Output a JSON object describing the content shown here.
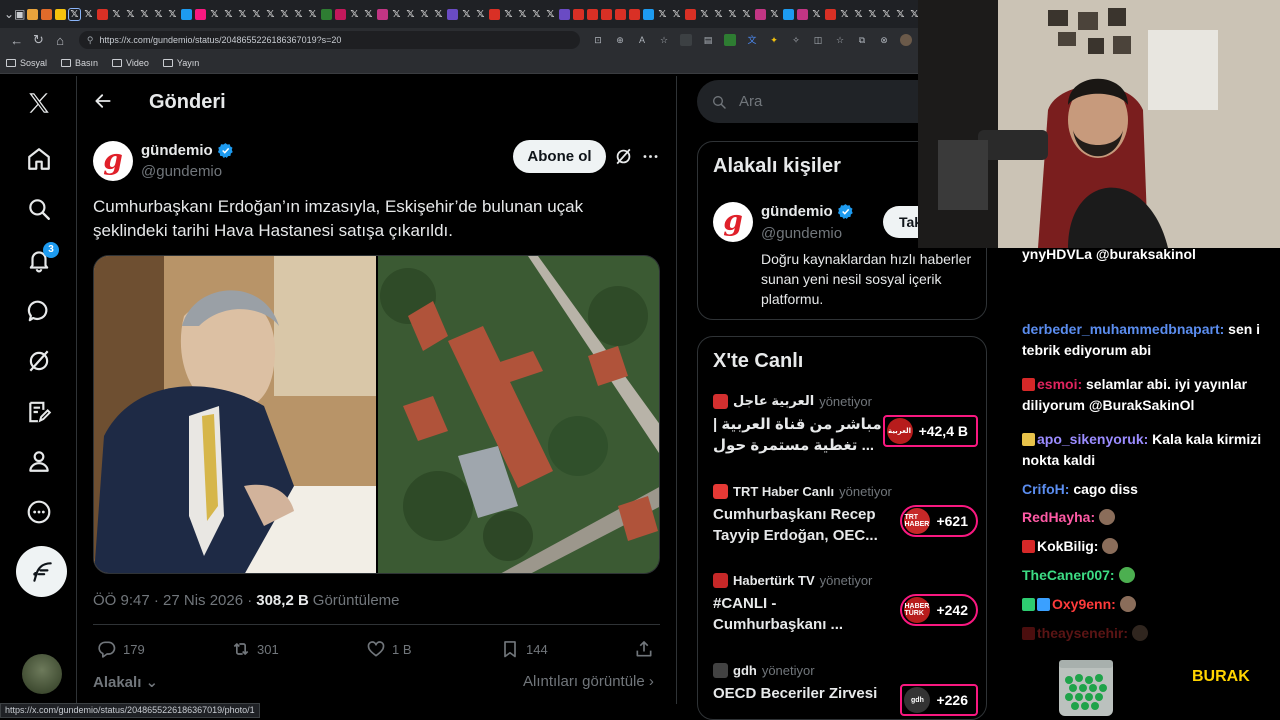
{
  "browser": {
    "url": "https://x.com/gundemio/status/2048655226186367019?s=20",
    "status_url": "https://x.com/gundemio/status/2048655226186367019/photo/1",
    "bookmarks": [
      "Sosyal",
      "Basın",
      "Video",
      "Yayın"
    ],
    "tab_favicons": [
      "#e8a33c",
      "#e06b2a",
      "#f4c20d",
      "x",
      "x",
      "#d93025",
      "x",
      "x",
      "x",
      "x",
      "x",
      "#1d9bf0",
      "#f91880",
      "x",
      "x",
      "x",
      "x",
      "x",
      "x",
      "x",
      "x",
      "#2e7d32",
      "#c2185b",
      "x",
      "x",
      "#c13584",
      "x",
      "x",
      "x",
      "x",
      "#6a4bc4",
      "x",
      "x",
      "#d93025",
      "x",
      "x",
      "x",
      "x",
      "#6a4bc4",
      "#d93025",
      "#d93025",
      "#d93025",
      "#d93025",
      "#d93025",
      "#1d9bf0",
      "x",
      "x",
      "#d93025",
      "x",
      "x",
      "x",
      "x",
      "#c13584",
      "x",
      "#1d9bf0",
      "#c13584",
      "x",
      "#d93025",
      "x",
      "x",
      "x",
      "x",
      "x",
      "x",
      "x",
      "x",
      "#6a4bc4",
      "x",
      "x"
    ]
  },
  "nav": {
    "notifications_badge": "3"
  },
  "main": {
    "title": "Gönderi",
    "author": {
      "name": "gündemio",
      "handle": "@gundemio",
      "avatar_letter": "g"
    },
    "subscribe_label": "Abone ol",
    "post_text": "Cumhurbaşkanı Erdoğan’ın imzasıyla, Eskişehir’de bulunan uçak şeklindeki tarihi Hava Hastanesi satışa çıkarıldı.",
    "time": "ÖÖ 9:47 · 27 Nis 2026 ·",
    "views_count": "308,2 B",
    "views_label": "Görüntüleme",
    "actions": {
      "replies": "179",
      "reposts": "301",
      "likes": "1 B",
      "bookmarks": "144"
    },
    "sort_label": "Alakalı",
    "quotes_label": "Alıntıları görüntüle"
  },
  "search": {
    "placeholder": "Ara"
  },
  "related": {
    "title": "Alakalı kişiler",
    "name": "gündemio",
    "handle": "@gundemio",
    "avatar_letter": "g",
    "bio": "Doğru kaynaklardan hızlı haberler sunan yeni nesil sosyal içerik platformu.",
    "follow_label": "Takip et"
  },
  "live": {
    "title": "X'te Canlı",
    "items": [
      {
        "host": "العربية عاجل",
        "hosting": "yönetiyor",
        "title": "مباشر من قناة العربية | تغطية مستمرة حول ...",
        "count": "+42,4 B",
        "thumb": "العربية",
        "thumb_color": "#b71c1c",
        "icon_color": "#d32f2f"
      },
      {
        "host": "TRT Haber Canlı",
        "hosting": "yönetiyor",
        "title": "Cumhurbaşkanı Recep Tayyip Erdoğan, OEC...",
        "count": "+621",
        "thumb": "TRT HABER",
        "thumb_color": "#c62828",
        "icon_color": "#e53935"
      },
      {
        "host": "Habertürk TV",
        "hosting": "yönetiyor",
        "title": "#CANLI - Cumhurbaşkanı ...",
        "count": "+242",
        "thumb": "HABER TÜRK",
        "thumb_color": "#b71c1c",
        "icon_color": "#c62828"
      },
      {
        "host": "gdh",
        "hosting": "yönetiyor",
        "title": "OECD Beceriler Zirvesi",
        "count": "+226",
        "thumb": "gdh",
        "thumb_color": "#333333",
        "icon_color": "#424242"
      }
    ]
  },
  "chat": {
    "lines": [
      {
        "user": "",
        "text": "ynyHDVLa @buraksakinol",
        "color": "#ffffff"
      },
      {
        "user": "derbeder_muhammedbnapart:",
        "text": " sen i tebrik ediyorum abi",
        "color": "#5b8def"
      },
      {
        "user": "esmoi:",
        "text": " selamlar abi. iyi yayınlar diliyorum @BurakSakinOl",
        "color": "#e0245e"
      },
      {
        "user": "apo_sikenyoruk:",
        "text": " Kala kala kirmizi nokta kaldi",
        "color": "#9b8cff"
      },
      {
        "user": "CrifoH:",
        "text": " cago diss",
        "color": "#5b8def"
      },
      {
        "user": "RedHayha:",
        "text": "",
        "color": "#ff5aa5"
      },
      {
        "user": "KokBilig:",
        "text": "",
        "color": "#ffffff"
      },
      {
        "user": "TheCaner007:",
        "text": "",
        "color": "#3ddc84"
      },
      {
        "user": "Oxy9enn:",
        "text": "",
        "color": "#ff3b3b"
      },
      {
        "user": "theaysenehir:",
        "text": "",
        "color": "#ff3b3b"
      }
    ],
    "overlay_name": "BURAK"
  }
}
